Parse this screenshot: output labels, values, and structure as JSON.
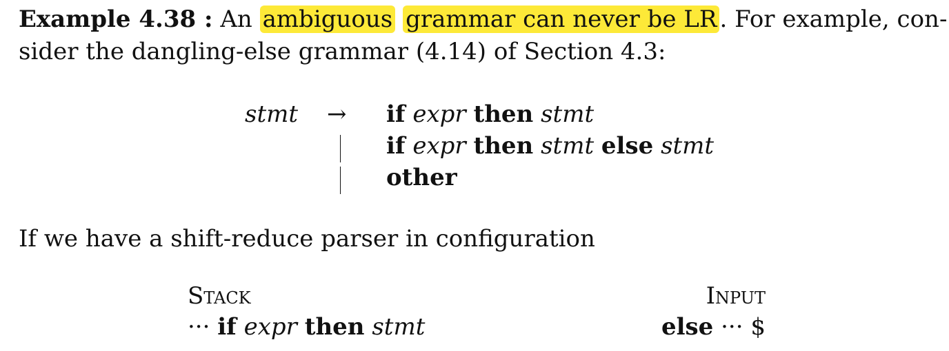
{
  "example": {
    "label": "Example 4.38 :",
    "p1_pre": " An ",
    "hl1": "ambiguous",
    "hl2": "grammar can never be LR",
    "p1_post": ". For example, con-",
    "p2": "sider the dangling-else grammar (4.14) of Section 4.3:"
  },
  "grammar": {
    "lhs": "stmt",
    "arrow": "→",
    "rows": [
      {
        "if": "if",
        "expr": "expr",
        "then": "then",
        "stmt": "stmt",
        "else": "",
        "stmt2": ""
      },
      {
        "if": "if",
        "expr": "expr",
        "then": "then",
        "stmt": "stmt",
        "else": "else",
        "stmt2": "stmt"
      },
      {
        "other": "other"
      }
    ]
  },
  "para2": "If we have a shift-reduce parser in configuration",
  "config": {
    "stack_header": "Stack",
    "input_header": "Input",
    "stack_dots": "···",
    "stack_if": "if",
    "stack_expr": "expr",
    "stack_then": "then",
    "stack_stmt": "stmt",
    "input_else": "else",
    "input_rest": "··· $"
  }
}
